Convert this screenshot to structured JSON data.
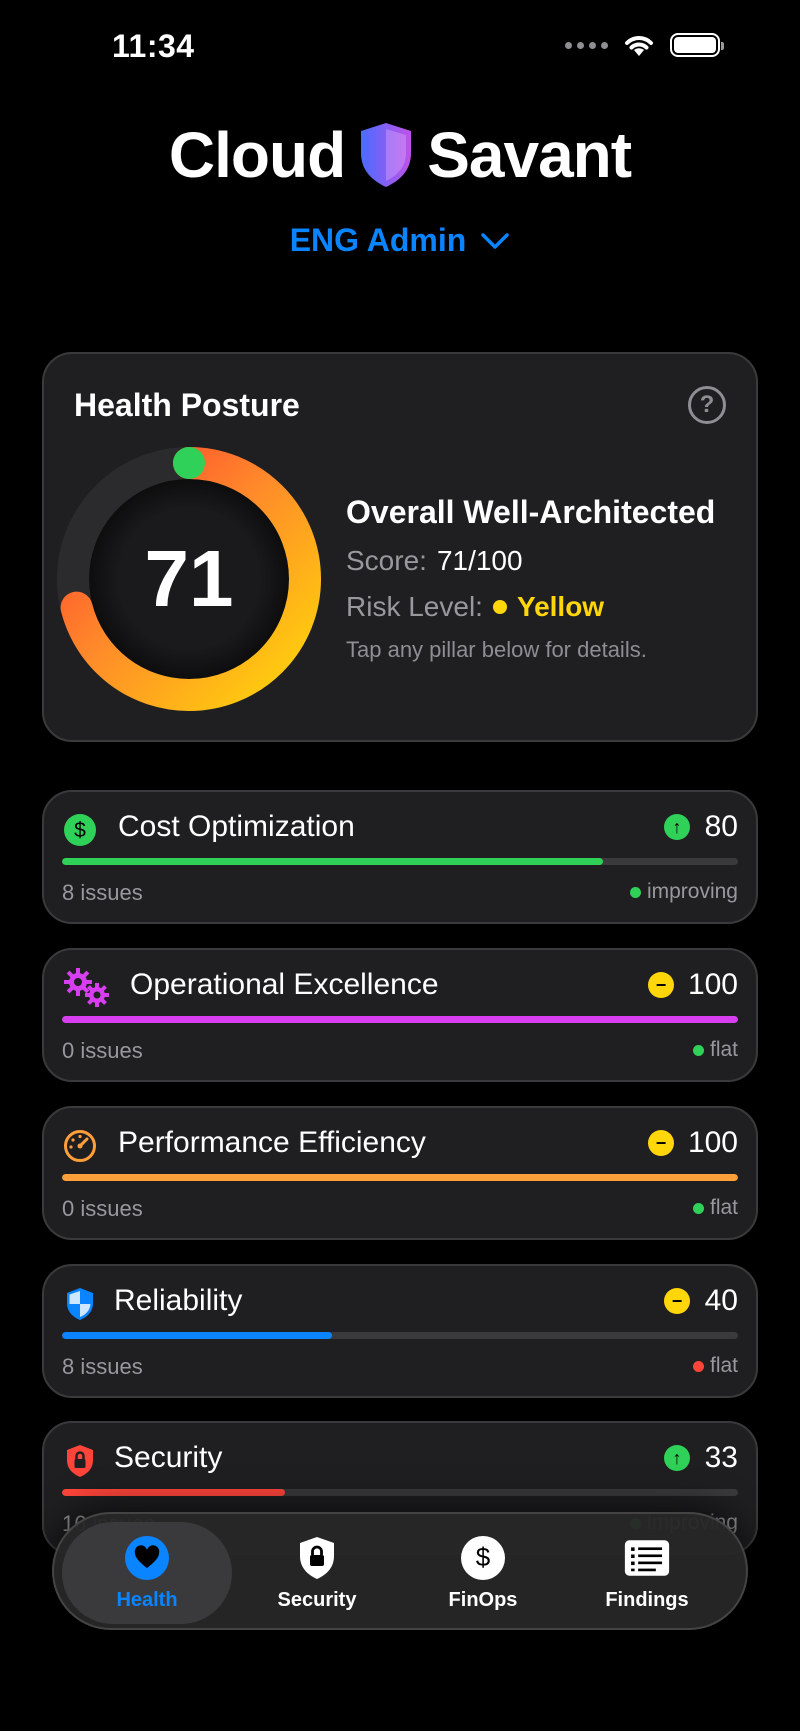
{
  "status_bar": {
    "time": "11:34"
  },
  "header": {
    "brand_left": "Cloud",
    "brand_right": "Savant",
    "account": "ENG Admin"
  },
  "health": {
    "title": "Health Posture",
    "score": "71",
    "score_fraction": 0.71,
    "summary_title": "Overall Well-Architected",
    "score_label": "Score:",
    "score_value": "71/100",
    "risk_label": "Risk Level:",
    "risk_value": "Yellow",
    "hint": "Tap any pillar below for details."
  },
  "pillars": [
    {
      "name": "Cost Optimization",
      "score": "80",
      "progress": 0.8,
      "issues": "8 issues",
      "status": "improving",
      "trend": "up",
      "icon": "dollar-icon",
      "color": "#30d158",
      "status_color": "#30d158"
    },
    {
      "name": "Operational Excellence",
      "score": "100",
      "progress": 1.0,
      "issues": "0 issues",
      "status": "flat",
      "trend": "flat",
      "icon": "gears-icon",
      "color": "#d63ef0",
      "status_color": "#30d158"
    },
    {
      "name": "Performance Efficiency",
      "score": "100",
      "progress": 1.0,
      "issues": "0 issues",
      "status": "flat",
      "trend": "flat",
      "icon": "speedometer-icon",
      "color": "#ff9f3a",
      "status_color": "#30d158"
    },
    {
      "name": "Reliability",
      "score": "40",
      "progress": 0.4,
      "issues": "8 issues",
      "status": "flat",
      "trend": "flat",
      "icon": "shield-half-icon",
      "color": "#0a84ff",
      "status_color": "#ff453a"
    },
    {
      "name": "Security",
      "score": "33",
      "progress": 0.33,
      "issues": "16 issues",
      "status": "improving",
      "trend": "up",
      "icon": "lock-shield-icon",
      "color": "#ff453a",
      "status_color": "#30d158"
    }
  ],
  "tabs": [
    {
      "label": "Health",
      "icon": "heart-icon",
      "active": true
    },
    {
      "label": "Security",
      "icon": "shield-lock-icon",
      "active": false
    },
    {
      "label": "FinOps",
      "icon": "dollar-circle-icon",
      "active": false
    },
    {
      "label": "Findings",
      "icon": "list-icon",
      "active": false
    }
  ],
  "colors": {
    "accent": "#0a84ff",
    "background": "#000000",
    "card": "#1f1f21",
    "risk_yellow": "#ffd60a"
  }
}
